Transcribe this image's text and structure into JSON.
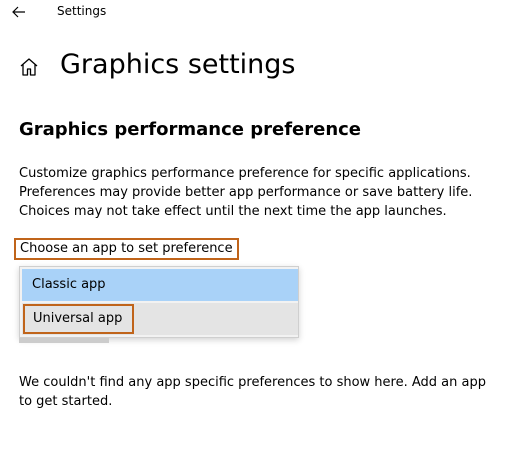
{
  "window": {
    "title": "Settings",
    "back_icon": "arrow-left-icon"
  },
  "header": {
    "home_icon": "home-icon",
    "page_title": "Graphics settings"
  },
  "section": {
    "title": "Graphics performance preference",
    "description_lines": [
      "Customize graphics performance preference for specific applications.",
      "Preferences may provide better app performance or save battery life.",
      "Choices may not take effect until the next time the app launches."
    ]
  },
  "app_picker": {
    "label": "Choose an app to set preference",
    "options": [
      {
        "label": "Classic app",
        "selected": true
      },
      {
        "label": "Universal app",
        "selected": false
      }
    ]
  },
  "empty_state": {
    "lines": [
      "We couldn't find any app specific preferences to show here. Add an app",
      "to get started."
    ]
  },
  "colors": {
    "highlight_outline": "#c0641a",
    "selected_option": "#a9d2f8",
    "hovered_option": "#e4e4e4"
  }
}
